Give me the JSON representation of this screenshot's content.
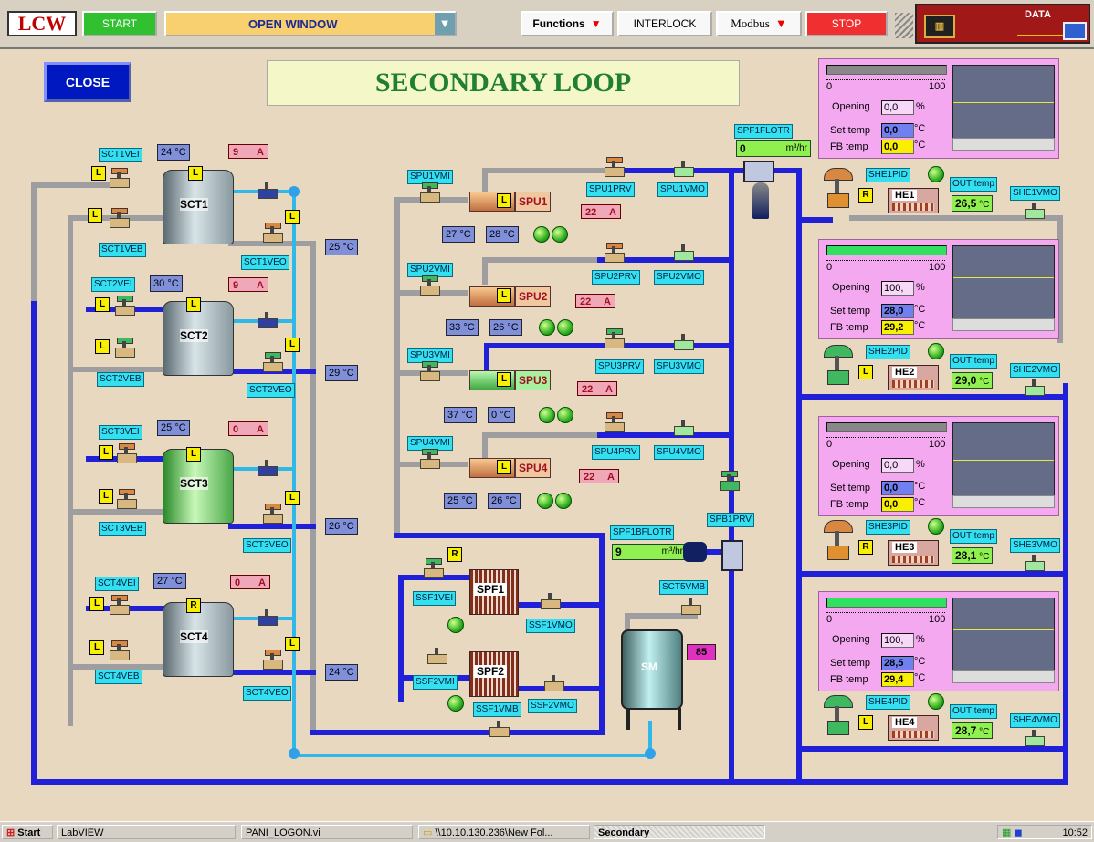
{
  "toolbar": {
    "logo": "LCW",
    "start": "START",
    "window_select": "OPEN WINDOW",
    "functions": "Functions",
    "interlock": "INTERLOCK",
    "modbus": "Modbus",
    "stop": "STOP",
    "data": "DATA"
  },
  "main": {
    "close": "CLOSE",
    "title": "SECONDARY LOOP"
  },
  "sct": [
    {
      "name": "SCT1",
      "vei": "SCT1VEI",
      "veb": "SCT1VEB",
      "veo": "SCT1VEO",
      "temp_in": "24",
      "amp": "9",
      "temp_out": "25"
    },
    {
      "name": "SCT2",
      "vei": "SCT2VEI",
      "veb": "SCT2VEB",
      "veo": "SCT2VEO",
      "temp_in": "30",
      "amp": "9",
      "temp_out": "29"
    },
    {
      "name": "SCT3",
      "vei": "SCT3VEI",
      "veb": "SCT3VEB",
      "veo": "SCT3VEO",
      "temp_in": "25",
      "amp": "0",
      "temp_out": "26"
    },
    {
      "name": "SCT4",
      "vei": "SCT4VEI",
      "veb": "SCT4VEB",
      "veo": "SCT4VEO",
      "temp_in": "27",
      "amp": "0",
      "temp_out": "24"
    }
  ],
  "spu": [
    {
      "name": "SPU1",
      "vmi": "SPU1VMI",
      "prv": "SPU1PRV",
      "vmo": "SPU1VMO",
      "t1": "27",
      "t2": "28",
      "amp": "22"
    },
    {
      "name": "SPU2",
      "vmi": "SPU2VMI",
      "prv": "SPU2PRV",
      "vmo": "SPU2VMO",
      "t1": "33",
      "t2": "26",
      "amp": "22"
    },
    {
      "name": "SPU3",
      "vmi": "SPU3VMI",
      "prv": "SPU3PRV",
      "vmo": "SPU3VMO",
      "t1": "37",
      "t2": "0",
      "amp": "22"
    },
    {
      "name": "SPU4",
      "vmi": "SPU4VMI",
      "prv": "SPU4PRV",
      "vmo": "SPU4VMO",
      "t1": "25",
      "t2": "26",
      "amp": "22"
    }
  ],
  "flow": {
    "spf1flotr": "SPF1FLOTR",
    "spf1flotr_val": "0",
    "spf1flotr_unit": "m³/hr",
    "spf1bflotr": "SPF1BFLOTR",
    "spf1bflotr_val": "9",
    "spf1bflotr_unit": "m³/hr",
    "spb1prv": "SPB1PRV"
  },
  "filters": {
    "spf1": "SPF1",
    "spf2": "SPF2",
    "ssf1vei": "SSF1VEI",
    "ssf1vmo": "SSF1VMO",
    "ssf2vmi": "SSF2VMI",
    "ssf2vmo": "SSF2VMO",
    "ssf1vmb": "SSF1VMB",
    "sct5vmb": "SCT5VMB",
    "sm": "SM",
    "sm_val": "85",
    "r": "R"
  },
  "units": {
    "c": "°C",
    "a": "A",
    "pct": "%"
  },
  "he": [
    {
      "pid": "SHE1PID",
      "name": "HE1",
      "out_label": "OUT temp",
      "out": "26,5",
      "vmo": "SHE1VMO",
      "opening": "0,0",
      "setp": "0,0",
      "fb": "0,0",
      "fill": 0,
      "tag": "R"
    },
    {
      "pid": "SHE2PID",
      "name": "HE2",
      "out_label": "OUT temp",
      "out": "29,0",
      "vmo": "SHE2VMO",
      "opening": "100,",
      "setp": "28,0",
      "fb": "29,2",
      "fill": 100,
      "tag": "L"
    },
    {
      "pid": "SHE3PID",
      "name": "HE3",
      "out_label": "OUT temp",
      "out": "28,1",
      "vmo": "SHE3VMO",
      "opening": "0,0",
      "setp": "0,0",
      "fb": "0,0",
      "fill": 0,
      "tag": "R"
    },
    {
      "pid": "SHE4PID",
      "name": "HE4",
      "out_label": "OUT temp",
      "out": "28,7",
      "vmo": "SHE4VMO",
      "opening": "100,",
      "setp": "28,5",
      "fb": "29,4",
      "fill": 100,
      "tag": "L"
    }
  ],
  "pid_labels": {
    "scale_min": "0",
    "scale_max": "100",
    "opening": "Opening",
    "set_temp": "Set temp",
    "fb_temp": "FB temp"
  },
  "taskbar": {
    "start": "Start",
    "t1": "LabVIEW",
    "t2": "PANI_LOGON.vi",
    "t3": "\\\\10.10.130.236\\New Fol...",
    "t4": "Secondary",
    "clock": "10:52"
  }
}
